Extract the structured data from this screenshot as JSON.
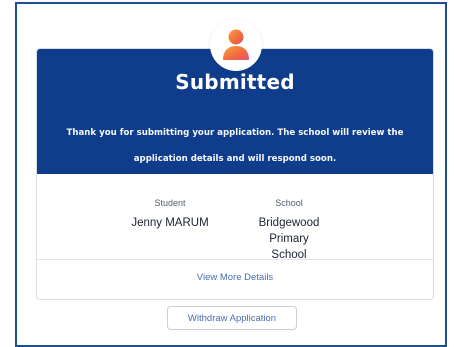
{
  "status": {
    "title": "Submitted",
    "message_line1": "Thank you for submitting your application. The school will review the",
    "message_line2": "application details and will respond soon."
  },
  "student": {
    "label": "Student",
    "name": "Jenny MARUM"
  },
  "school": {
    "label": "School",
    "name_line1": "Bridgewood Primary",
    "name_line2": "School"
  },
  "actions": {
    "view_details": "View More Details",
    "withdraw": "Withdraw Application"
  },
  "icons": {
    "avatar": "user-avatar-icon"
  },
  "colors": {
    "banner": "#0f3d8c",
    "border": "#1f4e8c",
    "link": "#4b6cb7",
    "avatar_orange": "#f47a3b",
    "avatar_pink": "#e84f7a"
  }
}
